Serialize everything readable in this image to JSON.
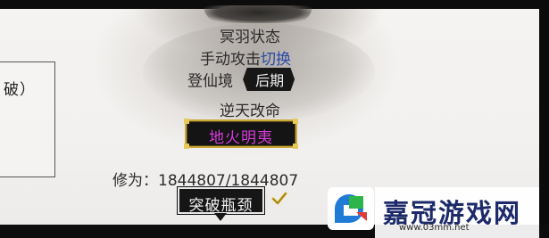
{
  "side_panel": {
    "partial_text": "破）"
  },
  "status": {
    "title": "冥羽状态",
    "attack_label": "手动攻击",
    "attack_switch": "切换",
    "realm_label": "登仙境",
    "realm_stage": "后期"
  },
  "fate": {
    "title": "逆天改命",
    "technique": "地火明夷"
  },
  "cultivation": {
    "label": "修为：",
    "current": "1844807",
    "max": "1844807"
  },
  "breakthrough": {
    "label": "突破瓶颈"
  },
  "icons": {
    "check": "check-icon",
    "logo": "logo-icon"
  },
  "watermark": {
    "brand": "嘉冠游戏网",
    "url": "www.03mm.net"
  },
  "colors": {
    "switch_link": "#2a4aa6",
    "technique_text": "#d23cd6",
    "gold_border": "#c8a838",
    "check_gold": "#d9b638"
  }
}
